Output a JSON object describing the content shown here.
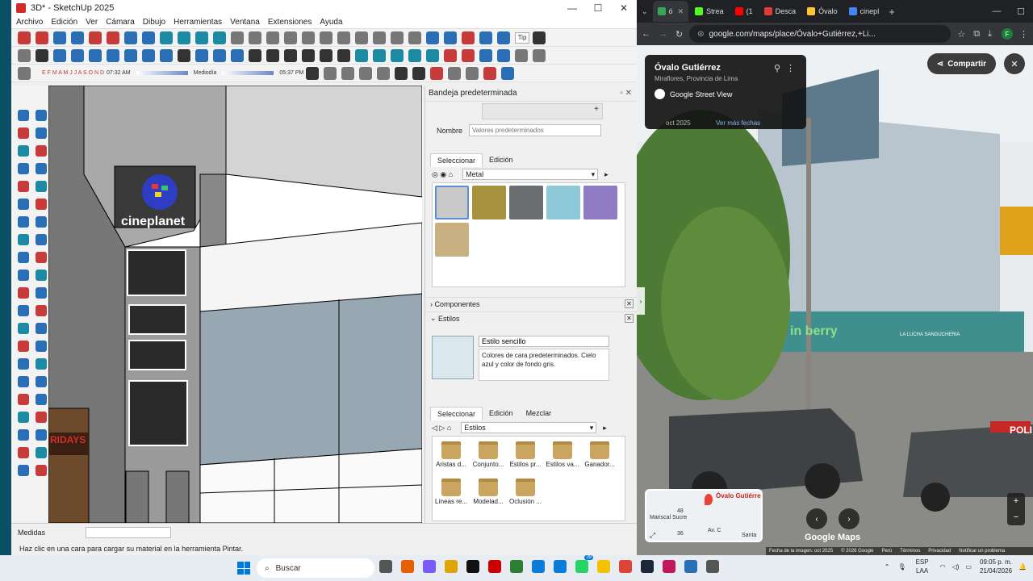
{
  "sketchup": {
    "title": "3D* - SketchUp 2025",
    "menu": [
      "Archivo",
      "Edición",
      "Ver",
      "Cámara",
      "Dibujo",
      "Herramientas",
      "Ventana",
      "Extensiones",
      "Ayuda"
    ],
    "toolbar_tip": "Tip",
    "shadow_months": "E F M A M J J A S O N D",
    "shadow_time_start": "07:32 AM",
    "shadow_time_mid": "Mediodía",
    "shadow_time_end": "05:37 PM",
    "status_label": "Medidas",
    "status_hint": "Haz clic en una cara para cargar su material en la herramienta Pintar."
  },
  "scene": {
    "sign_text": "cineplanet",
    "sign2_text": "RIDAYS"
  },
  "tray": {
    "title": "Bandeja predeterminada",
    "name_label": "Nombre",
    "name_placeholder": "Valores predeterminados",
    "mat_tab_select": "Seleccionar",
    "mat_tab_edit": "Edición",
    "mat_library": "Metal",
    "swatch_colors": [
      "#c9c9c9",
      "#a8913c",
      "#6b6e70",
      "#8ec9da",
      "#8e7bc4",
      "#c8b083"
    ],
    "components_label": "Componentes",
    "styles_label": "Estilos",
    "style_name": "Estilo sencillo",
    "style_desc": "Colores de cara predeterminados. Cielo azul y color de fondo gris.",
    "styles_tabs": [
      "Seleccionar",
      "Edición",
      "Mezclar"
    ],
    "styles_library": "Estilos",
    "folders": [
      "Aristas d...",
      "Conjunto...",
      "Estilos pr...",
      "Estilos va...",
      "Ganador...",
      "Líneas re...",
      "Modelad...",
      "Oclusión ..."
    ]
  },
  "chrome": {
    "tabs": [
      {
        "label": "ó",
        "color": "#34a853"
      },
      {
        "label": "Strea",
        "color": "#53fc18"
      },
      {
        "label": "(1",
        "color": "#ff0000"
      },
      {
        "label": "Desca",
        "color": "#e53935"
      },
      {
        "label": "Óvalo",
        "color": "#ffc72c"
      },
      {
        "label": "cinepl",
        "color": "#4285f4"
      }
    ],
    "url": "google.com/maps/place/Óvalo+Gutiérrez,+Li...",
    "profile_initial": "F",
    "place_title": "Óvalo Gutiérrez",
    "place_subtitle": "Miraflores, Provincia de Lima",
    "street_view_label": "Google Street View",
    "date": "oct 2025",
    "more_dates": "Ver más fechas",
    "share_label": "Compartir",
    "minimap_label": "Óvalo Gutiérre",
    "minimap_num1": "48",
    "minimap_num2": "36",
    "minimap_street1": "Mariscal Sucre",
    "minimap_street2": "Av. C",
    "minimap_street3": "Santa",
    "logo": "Google Maps",
    "footer": [
      "Fecha de la imagen: oct 2025",
      "© 2026 Google",
      "Perú",
      "Términos",
      "Privacidad",
      "Notificar un problema"
    ],
    "store_sign": "in berry",
    "store_sign2": "LA LUCHA SANGUCHERIA",
    "police_text": "POLI"
  },
  "taskbar": {
    "search_label": "Buscar",
    "lang_top": "ESP",
    "lang_bottom": "LAA",
    "time": "09:05 p. m.",
    "date": "21/04/2026",
    "app_colors": [
      "#555",
      "#e66000",
      "#7a5af8",
      "#e0a400",
      "#111",
      "#c00",
      "#2e7d32",
      "#0a7cd9",
      "#0a7cd9",
      "#25d366",
      "#f2c200",
      "#db4437",
      "#1b2838",
      "#c2185b",
      "#2a6fb5",
      "#555"
    ],
    "whatsapp_badge": "39"
  }
}
